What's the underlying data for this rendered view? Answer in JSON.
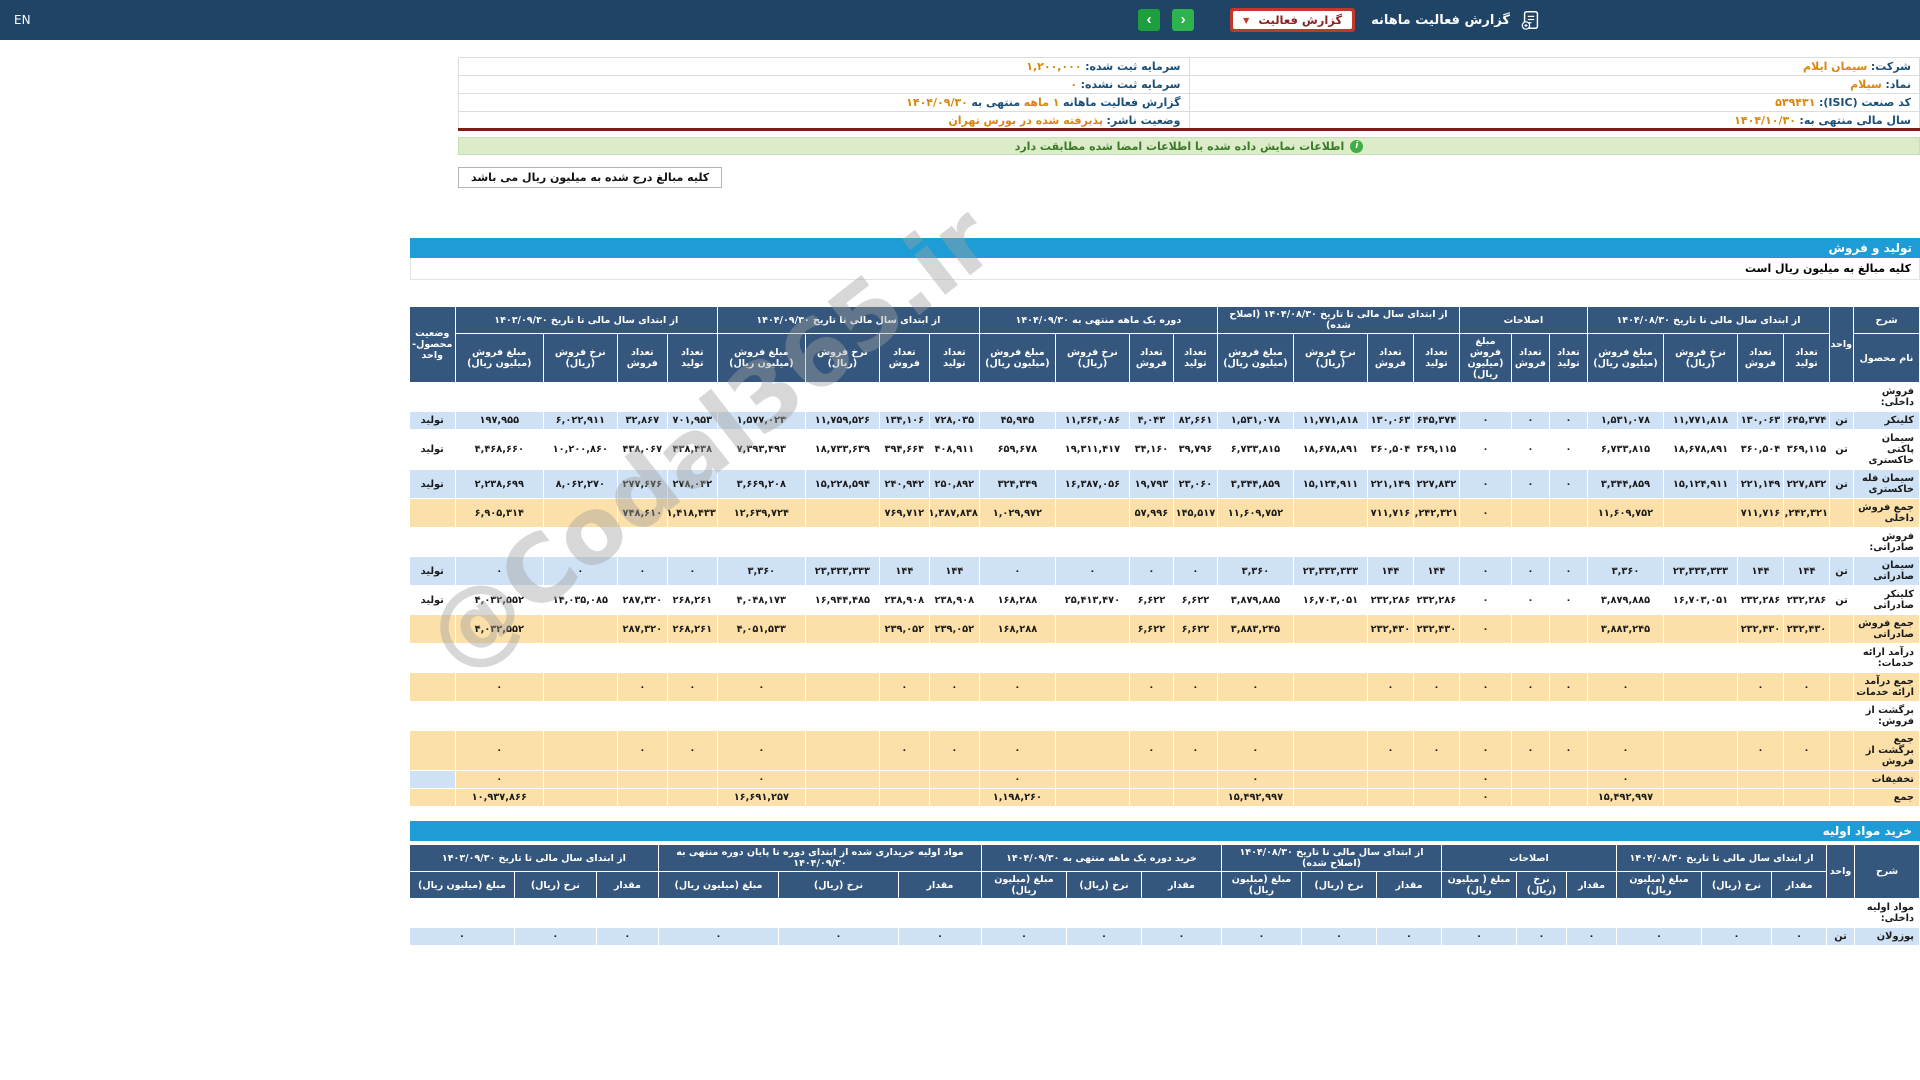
{
  "topbar": {
    "en": "EN",
    "title": "گزارش فعالیت ماهانه",
    "dropdown_label": "گزارش فعالیت"
  },
  "icons": {
    "caret": "▼",
    "next": "›",
    "prev": "‹",
    "info": "i"
  },
  "watermark": "@Codal365.ir",
  "info": {
    "rows": [
      {
        "r_label": "شرکت:",
        "r_value": "سیمان ایلام",
        "l_label": "سرمایه ثبت شده:",
        "l_value": "۱,۲۰۰,۰۰۰"
      },
      {
        "r_label": "نماد:",
        "r_value": "سیلام",
        "l_label": "سرمایه ثبت نشده:",
        "l_value": "۰"
      },
      {
        "r_label": "کد صنعت (ISIC):",
        "r_value": "۵۳۹۴۳۱",
        "l_label": "گزارش فعالیت ماهانه",
        "l_value": "۱ ماهه",
        "l_label2": "منتهی به",
        "l_value2": "۱۴۰۴/۰۹/۳۰"
      },
      {
        "r_label": "سال مالی منتهی به:",
        "r_value": "۱۴۰۴/۱۰/۳۰",
        "l_label": "وضعیت ناشر:",
        "l_value": "پذیرفته شده در بورس تهران"
      }
    ]
  },
  "banner": {
    "text": "اطلاعات نمایش داده شده با اطلاعات امضا شده مطابقت دارد"
  },
  "note": {
    "text": "کلیه مبالغ درج شده به میلیون ریال می باشد"
  },
  "sections": {
    "production_sales": "تولید و فروش",
    "sub_note": "کلیه مبالغ به میلیون ریال است",
    "raw_materials": "خرید مواد اولیه"
  },
  "table1": {
    "corner": {
      "desc": "شرح",
      "product": "نام محصول",
      "unit": "واحد",
      "status": "وضعیت محصول-واحد"
    },
    "groups": [
      {
        "title": "از ابتدای سال مالی تا تاریخ ۱۴۰۴/۰۸/۳۰",
        "cols": [
          "تعداد تولید",
          "تعداد فروش",
          "نرخ فروش (ریال)",
          "مبلغ فروش (میلیون ریال)"
        ]
      },
      {
        "title": "اصلاحات",
        "cols": [
          "تعداد تولید",
          "تعداد فروش",
          "مبلغ فروش (میلیون ریال)"
        ]
      },
      {
        "title": "از ابتدای سال مالی تا تاریخ ۱۴۰۴/۰۸/۳۰ (اصلاح شده)",
        "cols": [
          "تعداد تولید",
          "تعداد فروش",
          "نرخ فروش (ریال)",
          "مبلغ فروش (میلیون ریال)"
        ]
      },
      {
        "title": "دوره یک ماهه منتهی به ۱۴۰۴/۰۹/۳۰",
        "cols": [
          "تعداد تولید",
          "تعداد فروش",
          "نرخ فروش (ریال)",
          "مبلغ فروش (میلیون ریال)"
        ]
      },
      {
        "title": "از ابتدای سال مالی تا تاریخ ۱۴۰۴/۰۹/۳۰",
        "cols": [
          "تعداد تولید",
          "تعداد فروش",
          "نرخ فروش (ریال)",
          "مبلغ فروش (میلیون ریال)"
        ]
      },
      {
        "title": "از ابتدای سال مالی تا تاریخ ۱۴۰۳/۰۹/۳۰",
        "cols": [
          "تعداد تولید",
          "تعداد فروش",
          "نرخ فروش (ریال)",
          "مبلغ فروش (میلیون ریال)"
        ]
      }
    ],
    "rows": [
      {
        "type": "section",
        "bg": "white",
        "name": "فروش داخلی:"
      },
      {
        "type": "data",
        "bg": "blue",
        "name": "کلینکر",
        "unit": "تن",
        "status": "تولید",
        "cells": [
          "۶۴۵,۳۷۴",
          "۱۳۰,۰۶۳",
          "۱۱,۷۷۱,۸۱۸",
          "۱,۵۳۱,۰۷۸",
          "۰",
          "۰",
          "۰",
          "۶۴۵,۳۷۴",
          "۱۳۰,۰۶۳",
          "۱۱,۷۷۱,۸۱۸",
          "۱,۵۳۱,۰۷۸",
          "۸۲,۶۶۱",
          "۴,۰۴۳",
          "۱۱,۳۶۴,۰۸۶",
          "۴۵,۹۴۵",
          "۷۲۸,۰۳۵",
          "۱۳۴,۱۰۶",
          "۱۱,۷۵۹,۵۲۶",
          "۱,۵۷۷,۰۲۳",
          "۷۰۱,۹۵۳",
          "۳۲,۸۶۷",
          "۶,۰۲۲,۹۱۱",
          "۱۹۷,۹۵۵"
        ]
      },
      {
        "type": "data",
        "bg": "white",
        "name": "سیمان پاکتی خاکستری",
        "unit": "تن",
        "status": "تولید",
        "cells": [
          "۳۶۹,۱۱۵",
          "۳۶۰,۵۰۴",
          "۱۸,۶۷۸,۸۹۱",
          "۶,۷۳۳,۸۱۵",
          "۰",
          "۰",
          "۰",
          "۳۶۹,۱۱۵",
          "۳۶۰,۵۰۴",
          "۱۸,۶۷۸,۸۹۱",
          "۶,۷۳۳,۸۱۵",
          "۳۹,۷۹۶",
          "۳۴,۱۶۰",
          "۱۹,۳۱۱,۴۱۷",
          "۶۵۹,۶۷۸",
          "۴۰۸,۹۱۱",
          "۳۹۴,۶۶۴",
          "۱۸,۷۳۳,۶۳۹",
          "۷,۳۹۳,۴۹۳",
          "۴۳۸,۴۳۸",
          "۴۳۸,۰۶۷",
          "۱۰,۲۰۰,۸۶۰",
          "۴,۴۶۸,۶۶۰"
        ]
      },
      {
        "type": "data",
        "bg": "blue",
        "name": "سیمان فله خاکستری",
        "unit": "تن",
        "status": "تولید",
        "cells": [
          "۲۲۷,۸۳۲",
          "۲۲۱,۱۴۹",
          "۱۵,۱۲۴,۹۱۱",
          "۳,۳۴۴,۸۵۹",
          "۰",
          "۰",
          "۰",
          "۲۲۷,۸۳۲",
          "۲۲۱,۱۴۹",
          "۱۵,۱۲۴,۹۱۱",
          "۳,۳۴۴,۸۵۹",
          "۲۳,۰۶۰",
          "۱۹,۷۹۳",
          "۱۶,۳۸۷,۰۵۶",
          "۳۲۴,۳۴۹",
          "۲۵۰,۸۹۲",
          "۲۴۰,۹۴۲",
          "۱۵,۲۲۸,۵۹۴",
          "۳,۶۶۹,۲۰۸",
          "۲۷۸,۰۴۲",
          "۲۷۷,۶۷۶",
          "۸,۰۶۲,۲۷۰",
          "۲,۲۳۸,۶۹۹"
        ]
      },
      {
        "type": "data",
        "bg": "wheat",
        "name": "جمع فروش داخلی",
        "unit": "",
        "status": "",
        "cells": [
          "۱,۲۴۲,۳۲۱",
          "۷۱۱,۷۱۶",
          "",
          "۱۱,۶۰۹,۷۵۲",
          "",
          "",
          "۰",
          "۱,۲۴۲,۳۲۱",
          "۷۱۱,۷۱۶",
          "",
          "۱۱,۶۰۹,۷۵۲",
          "۱۴۵,۵۱۷",
          "۵۷,۹۹۶",
          "",
          "۱,۰۲۹,۹۷۲",
          "۱,۳۸۷,۸۳۸",
          "۷۶۹,۷۱۲",
          "",
          "۱۲,۶۳۹,۷۲۴",
          "۱,۴۱۸,۴۳۳",
          "۷۴۸,۶۱۰",
          "",
          "۶,۹۰۵,۳۱۴"
        ]
      },
      {
        "type": "section",
        "bg": "white",
        "name": "فروش صادراتی:"
      },
      {
        "type": "data",
        "bg": "blue",
        "name": "سیمان صادراتی",
        "unit": "تن",
        "status": "تولید",
        "cells": [
          "۱۴۴",
          "۱۴۴",
          "۲۳,۳۳۳,۳۳۳",
          "۳,۳۶۰",
          "۰",
          "۰",
          "۰",
          "۱۴۴",
          "۱۴۴",
          "۲۳,۳۳۳,۳۳۳",
          "۳,۳۶۰",
          "۰",
          "۰",
          "۰",
          "۰",
          "۱۴۴",
          "۱۴۴",
          "۲۳,۳۳۳,۳۳۳",
          "۳,۳۶۰",
          "۰",
          "۰",
          "۰",
          "۰"
        ]
      },
      {
        "type": "data",
        "bg": "white",
        "name": "کلینکر صادراتی",
        "unit": "تن",
        "status": "تولید",
        "cells": [
          "۲۳۲,۲۸۶",
          "۲۳۲,۲۸۶",
          "۱۶,۷۰۳,۰۵۱",
          "۳,۸۷۹,۸۸۵",
          "۰",
          "۰",
          "۰",
          "۲۳۲,۲۸۶",
          "۲۳۲,۲۸۶",
          "۱۶,۷۰۳,۰۵۱",
          "۳,۸۷۹,۸۸۵",
          "۶,۶۲۲",
          "۶,۶۲۲",
          "۲۵,۴۱۳,۴۷۰",
          "۱۶۸,۲۸۸",
          "۲۳۸,۹۰۸",
          "۲۳۸,۹۰۸",
          "۱۶,۹۴۴,۴۸۵",
          "۴,۰۴۸,۱۷۳",
          "۲۶۸,۲۶۱",
          "۲۸۷,۳۲۰",
          "۱۴,۰۳۵,۰۸۵",
          "۴,۰۳۲,۵۵۲"
        ]
      },
      {
        "type": "data",
        "bg": "wheat",
        "name": "جمع فروش صادراتی",
        "unit": "",
        "status": "",
        "cells": [
          "۲۳۲,۴۳۰",
          "۲۳۲,۴۳۰",
          "",
          "۳,۸۸۳,۲۴۵",
          "",
          "",
          "۰",
          "۲۳۲,۴۳۰",
          "۲۳۲,۴۳۰",
          "",
          "۳,۸۸۳,۲۴۵",
          "۶,۶۲۲",
          "۶,۶۲۲",
          "",
          "۱۶۸,۲۸۸",
          "۲۳۹,۰۵۲",
          "۲۳۹,۰۵۲",
          "",
          "۴,۰۵۱,۵۳۳",
          "۲۶۸,۲۶۱",
          "۲۸۷,۳۲۰",
          "",
          "۴,۰۳۲,۵۵۲"
        ]
      },
      {
        "type": "section",
        "bg": "white",
        "name": "درآمد ارائه خدمات:"
      },
      {
        "type": "data",
        "bg": "wheat",
        "name": "جمع درآمد ارائه خدمات",
        "unit": "",
        "status": "",
        "cells": [
          "۰",
          "۰",
          "",
          "۰",
          "۰",
          "۰",
          "۰",
          "۰",
          "۰",
          "",
          "۰",
          "۰",
          "۰",
          "",
          "۰",
          "۰",
          "۰",
          "",
          "۰",
          "۰",
          "۰",
          "",
          "۰"
        ]
      },
      {
        "type": "section",
        "bg": "white",
        "name": "برگشت از فروش:"
      },
      {
        "type": "data",
        "bg": "wheat",
        "name": "جمع برگشت از فروش",
        "unit": "",
        "status": "",
        "cells": [
          "۰",
          "۰",
          "",
          "۰",
          "۰",
          "۰",
          "۰",
          "۰",
          "۰",
          "",
          "۰",
          "۰",
          "۰",
          "",
          "۰",
          "۰",
          "۰",
          "",
          "۰",
          "۰",
          "۰",
          "",
          "۰"
        ]
      },
      {
        "type": "data",
        "bg": "wheat",
        "name": "تخفیفات",
        "unit": "",
        "status": "",
        "status_bg": "blue",
        "cells": [
          "",
          "",
          "",
          "۰",
          "",
          "",
          "۰",
          "",
          "",
          "",
          "۰",
          "",
          "",
          "",
          "۰",
          "",
          "",
          "",
          "۰",
          "",
          "",
          "",
          "۰"
        ]
      },
      {
        "type": "data",
        "bg": "wheat",
        "name": "جمع",
        "unit": "",
        "status": "",
        "cells": [
          "",
          "",
          "",
          "۱۵,۴۹۲,۹۹۷",
          "",
          "",
          "۰",
          "",
          "",
          "",
          "۱۵,۴۹۲,۹۹۷",
          "",
          "",
          "",
          "۱,۱۹۸,۲۶۰",
          "",
          "",
          "",
          "۱۶,۶۹۱,۲۵۷",
          "",
          "",
          "",
          "۱۰,۹۳۷,۸۶۶"
        ]
      }
    ]
  },
  "table2": {
    "corner": {
      "desc": "شرح",
      "unit": "واحد"
    },
    "groups": [
      {
        "title": "از ابتدای سال مالی تا تاریخ ۱۴۰۴/۰۸/۳۰",
        "cols": [
          "مقدار",
          "نرخ (ریال)",
          "مبلغ (میلیون ریال)"
        ]
      },
      {
        "title": "اصلاحات",
        "cols": [
          "مقدار",
          "نرخ (ریال)",
          "مبلغ ( میلیون ریال)"
        ]
      },
      {
        "title": "از ابتدای سال مالی تا تاریخ ۱۴۰۴/۰۸/۳۰ (اصلاح شده)",
        "cols": [
          "مقدار",
          "نرخ (ریال)",
          "مبلغ (میلیون ریال)"
        ]
      },
      {
        "title": "خرید دوره یک ماهه منتهی به ۱۴۰۴/۰۹/۳۰",
        "cols": [
          "مقدار",
          "نرخ (ریال)",
          "مبلغ (میلیون ریال)"
        ]
      },
      {
        "title": "مواد اولیه خریداری شده از ابتدای دوره تا پایان دوره منتهی به ۱۴۰۴/۰۹/۳۰",
        "cols": [
          "مقدار",
          "نرخ (ریال)",
          "مبلغ (میلیون ریال)"
        ]
      },
      {
        "title": "از ابتدای سال مالی تا تاریخ ۱۴۰۳/۰۹/۳۰",
        "cols": [
          "مقدار",
          "نرخ (ریال)",
          "مبلغ (میلیون ریال)"
        ]
      }
    ],
    "rows": [
      {
        "type": "section",
        "bg": "white",
        "name": "مواد اولیه داخلی:"
      },
      {
        "type": "data",
        "bg": "blue",
        "name": "پوزولان",
        "unit": "تن",
        "cells": [
          "۰",
          "۰",
          "۰",
          "۰",
          "۰",
          "۰",
          "۰",
          "۰",
          "۰",
          "۰",
          "۰",
          "۰",
          "۰",
          "۰",
          "۰",
          "۰",
          "۰",
          "۰"
        ]
      }
    ]
  }
}
